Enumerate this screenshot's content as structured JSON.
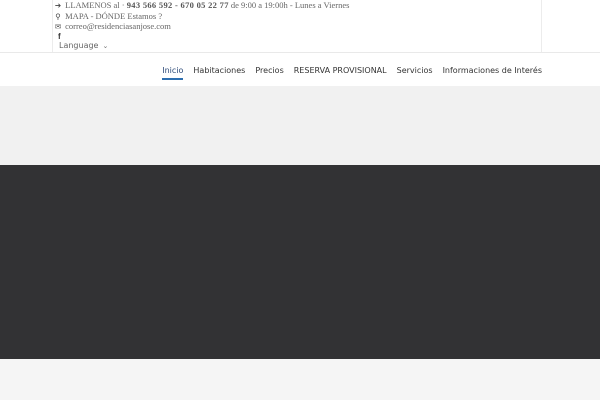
{
  "contact": {
    "phone_icon": "arrow-right-icon",
    "phone_prefix": "LLAMENOS al · ",
    "phone_numbers": "943 566 592 - 670 05 22 77",
    "phone_suffix": " de 9:00 a 19:00h - Lunes a Viernes",
    "map_icon": "map-pin-icon",
    "map_label": "MAPA - DÓNDE Estamos ?",
    "email_icon": "envelope-icon",
    "email": "correo@residenciasanjose.com"
  },
  "social": {
    "facebook_icon": "facebook-icon"
  },
  "language": {
    "label": "Language",
    "chevron_icon": "chevron-down-icon"
  },
  "nav": {
    "items": [
      {
        "label": "Inicio",
        "active": true
      },
      {
        "label": "Habitaciones"
      },
      {
        "label": "Precios"
      },
      {
        "label": "RESERVA PROVISIONAL"
      },
      {
        "label": "Servicios"
      },
      {
        "label": "Informaciones de Interés"
      }
    ]
  },
  "colors": {
    "accent": "#2e6fb0",
    "dark_band": "#323234",
    "light_band": "#f1f1f1"
  }
}
